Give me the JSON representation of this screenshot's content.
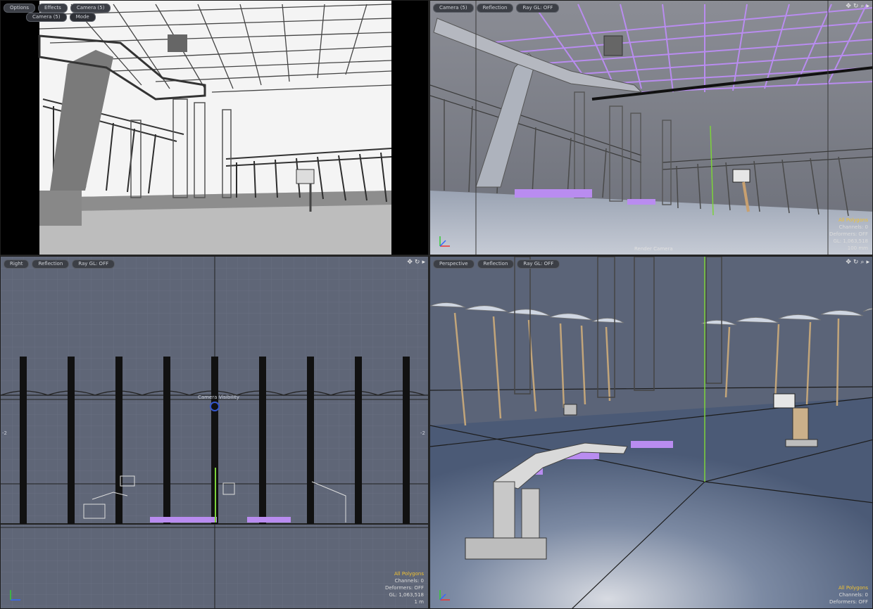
{
  "viewports": {
    "top_left": {
      "tabs": [
        "Options",
        "Effects",
        "Camera (5)"
      ],
      "subtabs": [
        "Camera (5)",
        "Mode"
      ]
    },
    "top_right": {
      "tabs": [
        "Camera (5)",
        "Reflection",
        "Ray GL: OFF"
      ],
      "caption": "Render Camera",
      "stats": {
        "polygons": "All Polygons",
        "channels": "Channels: 0",
        "deformers": "Deformers: OFF",
        "gl": "GL: 1,063,518",
        "scale": "100 mm"
      }
    },
    "bottom_left": {
      "tabs": [
        "Right",
        "Reflection",
        "Ray GL: OFF"
      ],
      "caption": "Camera Visibility",
      "axis_marks": [
        "-2",
        "-2"
      ],
      "stats": {
        "polygons": "All Polygons",
        "channels": "Channels: 0",
        "deformers": "Deformers: OFF",
        "gl": "GL: 1,063,518",
        "scale": "1 m"
      }
    },
    "bottom_right": {
      "tabs": [
        "Perspective",
        "Reflection",
        "Ray GL: OFF"
      ],
      "stats": {
        "polygons": "All Polygons",
        "channels": "Channels: 0",
        "deformers": "Deformers: OFF"
      }
    }
  },
  "toolbar_icons": [
    "move-icon",
    "rotate-icon",
    "zoom-icon",
    "menu-arrow-icon"
  ],
  "colors": {
    "accent": "#f1c232",
    "selection": "#b98cf0",
    "guide": "#7cd33a"
  }
}
